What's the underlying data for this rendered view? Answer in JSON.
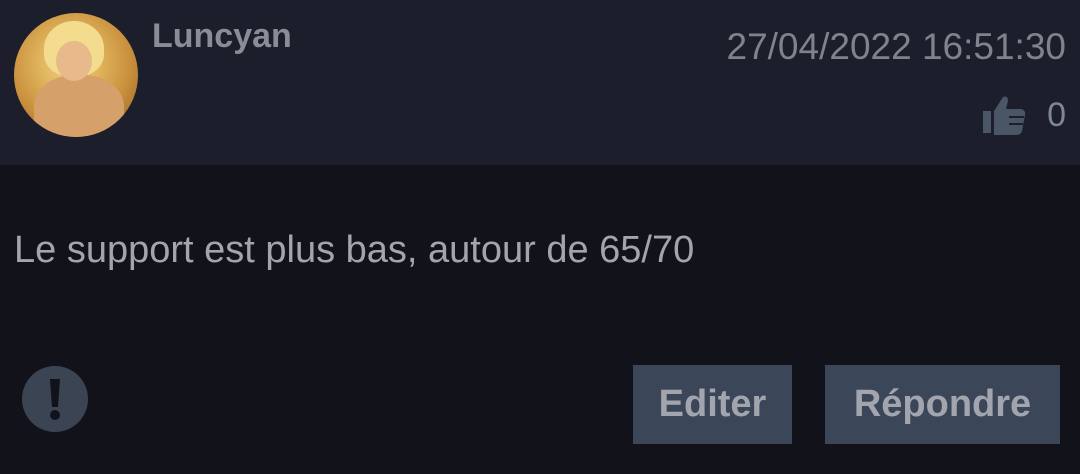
{
  "post": {
    "author": "Luncyan",
    "timestamp": "27/04/2022 16:51:30",
    "likes": "0",
    "message": "Le support est plus bas, autour de 65/70"
  },
  "actions": {
    "edit_label": "Editer",
    "reply_label": "Répondre"
  },
  "icons": {
    "like": "thumbs-up-icon",
    "report": "exclamation-icon"
  },
  "colors": {
    "header_bg": "#1c1e2b",
    "page_bg": "#12121b",
    "button_bg": "#3b4759"
  }
}
